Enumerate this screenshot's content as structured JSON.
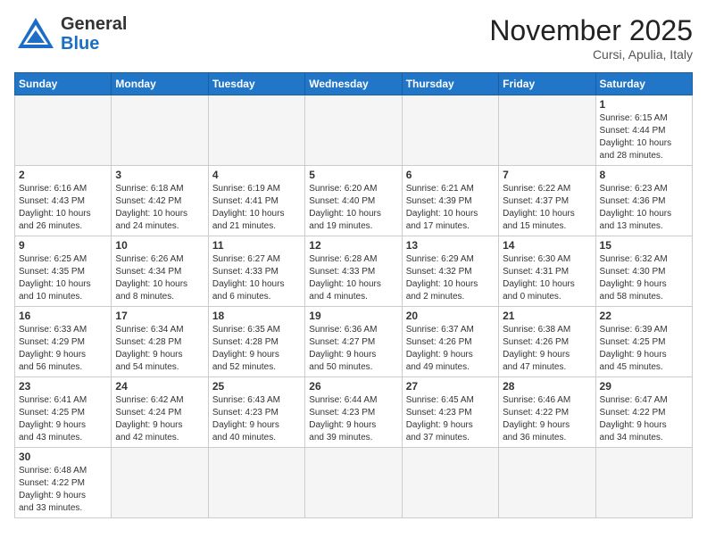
{
  "header": {
    "logo_general": "General",
    "logo_blue": "Blue",
    "month_title": "November 2025",
    "location": "Cursi, Apulia, Italy"
  },
  "weekdays": [
    "Sunday",
    "Monday",
    "Tuesday",
    "Wednesday",
    "Thursday",
    "Friday",
    "Saturday"
  ],
  "weeks": [
    [
      {
        "day": "",
        "info": ""
      },
      {
        "day": "",
        "info": ""
      },
      {
        "day": "",
        "info": ""
      },
      {
        "day": "",
        "info": ""
      },
      {
        "day": "",
        "info": ""
      },
      {
        "day": "",
        "info": ""
      },
      {
        "day": "1",
        "info": "Sunrise: 6:15 AM\nSunset: 4:44 PM\nDaylight: 10 hours\nand 28 minutes."
      }
    ],
    [
      {
        "day": "2",
        "info": "Sunrise: 6:16 AM\nSunset: 4:43 PM\nDaylight: 10 hours\nand 26 minutes."
      },
      {
        "day": "3",
        "info": "Sunrise: 6:18 AM\nSunset: 4:42 PM\nDaylight: 10 hours\nand 24 minutes."
      },
      {
        "day": "4",
        "info": "Sunrise: 6:19 AM\nSunset: 4:41 PM\nDaylight: 10 hours\nand 21 minutes."
      },
      {
        "day": "5",
        "info": "Sunrise: 6:20 AM\nSunset: 4:40 PM\nDaylight: 10 hours\nand 19 minutes."
      },
      {
        "day": "6",
        "info": "Sunrise: 6:21 AM\nSunset: 4:39 PM\nDaylight: 10 hours\nand 17 minutes."
      },
      {
        "day": "7",
        "info": "Sunrise: 6:22 AM\nSunset: 4:37 PM\nDaylight: 10 hours\nand 15 minutes."
      },
      {
        "day": "8",
        "info": "Sunrise: 6:23 AM\nSunset: 4:36 PM\nDaylight: 10 hours\nand 13 minutes."
      }
    ],
    [
      {
        "day": "9",
        "info": "Sunrise: 6:25 AM\nSunset: 4:35 PM\nDaylight: 10 hours\nand 10 minutes."
      },
      {
        "day": "10",
        "info": "Sunrise: 6:26 AM\nSunset: 4:34 PM\nDaylight: 10 hours\nand 8 minutes."
      },
      {
        "day": "11",
        "info": "Sunrise: 6:27 AM\nSunset: 4:33 PM\nDaylight: 10 hours\nand 6 minutes."
      },
      {
        "day": "12",
        "info": "Sunrise: 6:28 AM\nSunset: 4:33 PM\nDaylight: 10 hours\nand 4 minutes."
      },
      {
        "day": "13",
        "info": "Sunrise: 6:29 AM\nSunset: 4:32 PM\nDaylight: 10 hours\nand 2 minutes."
      },
      {
        "day": "14",
        "info": "Sunrise: 6:30 AM\nSunset: 4:31 PM\nDaylight: 10 hours\nand 0 minutes."
      },
      {
        "day": "15",
        "info": "Sunrise: 6:32 AM\nSunset: 4:30 PM\nDaylight: 9 hours\nand 58 minutes."
      }
    ],
    [
      {
        "day": "16",
        "info": "Sunrise: 6:33 AM\nSunset: 4:29 PM\nDaylight: 9 hours\nand 56 minutes."
      },
      {
        "day": "17",
        "info": "Sunrise: 6:34 AM\nSunset: 4:28 PM\nDaylight: 9 hours\nand 54 minutes."
      },
      {
        "day": "18",
        "info": "Sunrise: 6:35 AM\nSunset: 4:28 PM\nDaylight: 9 hours\nand 52 minutes."
      },
      {
        "day": "19",
        "info": "Sunrise: 6:36 AM\nSunset: 4:27 PM\nDaylight: 9 hours\nand 50 minutes."
      },
      {
        "day": "20",
        "info": "Sunrise: 6:37 AM\nSunset: 4:26 PM\nDaylight: 9 hours\nand 49 minutes."
      },
      {
        "day": "21",
        "info": "Sunrise: 6:38 AM\nSunset: 4:26 PM\nDaylight: 9 hours\nand 47 minutes."
      },
      {
        "day": "22",
        "info": "Sunrise: 6:39 AM\nSunset: 4:25 PM\nDaylight: 9 hours\nand 45 minutes."
      }
    ],
    [
      {
        "day": "23",
        "info": "Sunrise: 6:41 AM\nSunset: 4:25 PM\nDaylight: 9 hours\nand 43 minutes."
      },
      {
        "day": "24",
        "info": "Sunrise: 6:42 AM\nSunset: 4:24 PM\nDaylight: 9 hours\nand 42 minutes."
      },
      {
        "day": "25",
        "info": "Sunrise: 6:43 AM\nSunset: 4:23 PM\nDaylight: 9 hours\nand 40 minutes."
      },
      {
        "day": "26",
        "info": "Sunrise: 6:44 AM\nSunset: 4:23 PM\nDaylight: 9 hours\nand 39 minutes."
      },
      {
        "day": "27",
        "info": "Sunrise: 6:45 AM\nSunset: 4:23 PM\nDaylight: 9 hours\nand 37 minutes."
      },
      {
        "day": "28",
        "info": "Sunrise: 6:46 AM\nSunset: 4:22 PM\nDaylight: 9 hours\nand 36 minutes."
      },
      {
        "day": "29",
        "info": "Sunrise: 6:47 AM\nSunset: 4:22 PM\nDaylight: 9 hours\nand 34 minutes."
      }
    ],
    [
      {
        "day": "30",
        "info": "Sunrise: 6:48 AM\nSunset: 4:22 PM\nDaylight: 9 hours\nand 33 minutes."
      },
      {
        "day": "",
        "info": ""
      },
      {
        "day": "",
        "info": ""
      },
      {
        "day": "",
        "info": ""
      },
      {
        "day": "",
        "info": ""
      },
      {
        "day": "",
        "info": ""
      },
      {
        "day": "",
        "info": ""
      }
    ]
  ]
}
